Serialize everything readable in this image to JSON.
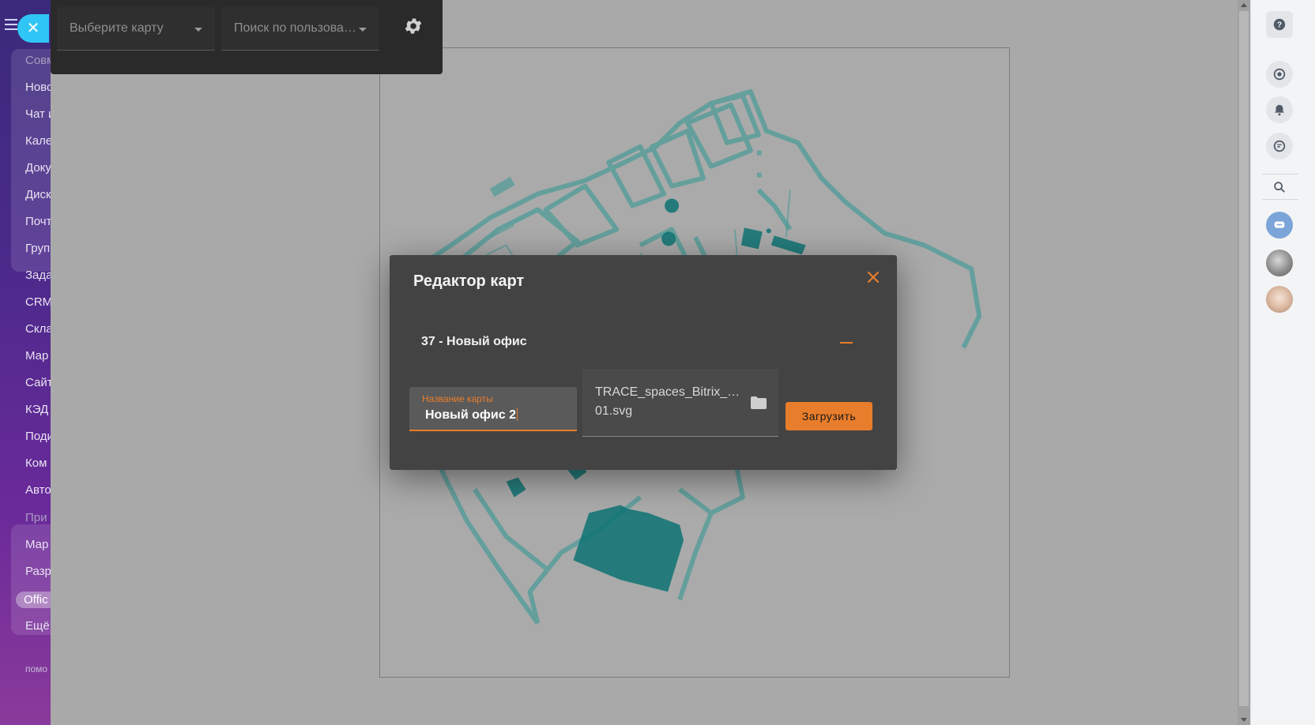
{
  "left_sidebar": {
    "items": [
      {
        "label": "Совм",
        "dim": true
      },
      {
        "label": "Ново"
      },
      {
        "label": "Чат и"
      },
      {
        "label": "Кале"
      },
      {
        "label": "Доку"
      },
      {
        "label": "Диск"
      },
      {
        "label": "Почт"
      },
      {
        "label": "Груп"
      },
      {
        "label": "Зада"
      },
      {
        "label": "CRM"
      },
      {
        "label": "Скла"
      },
      {
        "label": "Мар"
      },
      {
        "label": "Сайт"
      },
      {
        "label": "КЭД"
      },
      {
        "label": "Поди"
      },
      {
        "label": "Ком"
      },
      {
        "label": "Авто"
      },
      {
        "label": "При",
        "dim": true
      },
      {
        "label": "Мар"
      },
      {
        "label": "Разр"
      },
      {
        "label": "Offic",
        "active": true
      },
      {
        "label": "Ещё"
      },
      {
        "label": "помо"
      }
    ]
  },
  "toolbar": {
    "map_select_placeholder": "Выберите карту",
    "user_search_placeholder": "Поиск по пользова…"
  },
  "modal": {
    "title": "Редактор карт",
    "map_row_label": "37 - Новый офис",
    "name_field_label": "Название карты",
    "name_field_value": "Новый офис 2",
    "file_name": "TRACE_spaces_Bitrix_…01.svg",
    "upload_button": "Загрузить"
  },
  "right_panel": {
    "icons": [
      "help-icon",
      "sync-icon",
      "bell-icon",
      "chat-icon",
      "search-icon",
      "group-chat-icon"
    ]
  },
  "colors": {
    "accent": "#e87d2b",
    "modal_bg": "#434343",
    "toolbar_bg": "#2a2a2a",
    "overlay_bg": "#a9a9a9",
    "map_stroke": "#3f9a96",
    "map_fill": "#0e7373"
  }
}
